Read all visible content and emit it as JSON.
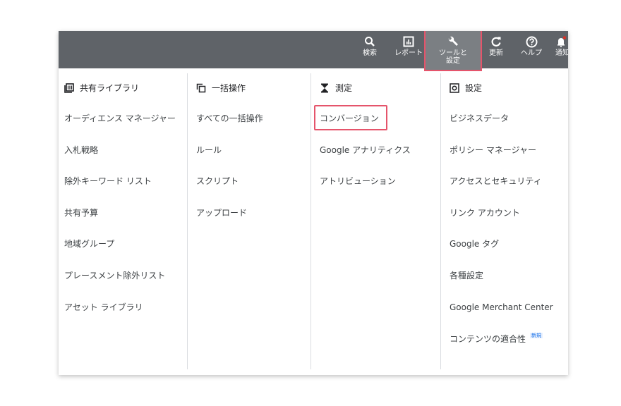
{
  "toolbar": {
    "search_label": "検索",
    "reports_label": "レポート",
    "tools_label": "ツールと\n設定",
    "tools_label_line1": "ツールと",
    "tools_label_line2": "設定",
    "refresh_label": "更新",
    "help_label": "ヘルプ",
    "notifications_label": "通知"
  },
  "columns": [
    {
      "header": "共有ライブラリ",
      "icon": "library-icon",
      "items": [
        "オーディエンス マネージャー",
        "入札戦略",
        "除外キーワード リスト",
        "共有予算",
        "地域グループ",
        "プレースメント除外リスト",
        "アセット ライブラリ"
      ]
    },
    {
      "header": "一括操作",
      "icon": "copy-icon",
      "items": [
        "すべての一括操作",
        "ルール",
        "スクリプト",
        "アップロード"
      ]
    },
    {
      "header": "測定",
      "icon": "hourglass-icon",
      "items": [
        "コンバージョン",
        "Google アナリティクス",
        "アトリビューション"
      ]
    },
    {
      "header": "設定",
      "icon": "settings-box-icon",
      "items": [
        "ビジネスデータ",
        "ポリシー マネージャー",
        "アクセスとセキュリティ",
        "リンク アカウント",
        "Google タグ",
        "各種設定",
        "Google Merchant Center",
        "コンテンツの適合性"
      ],
      "new_badge": "新規"
    }
  ],
  "colors": {
    "topbar": "#5f6368",
    "highlight": "#e5546b"
  }
}
